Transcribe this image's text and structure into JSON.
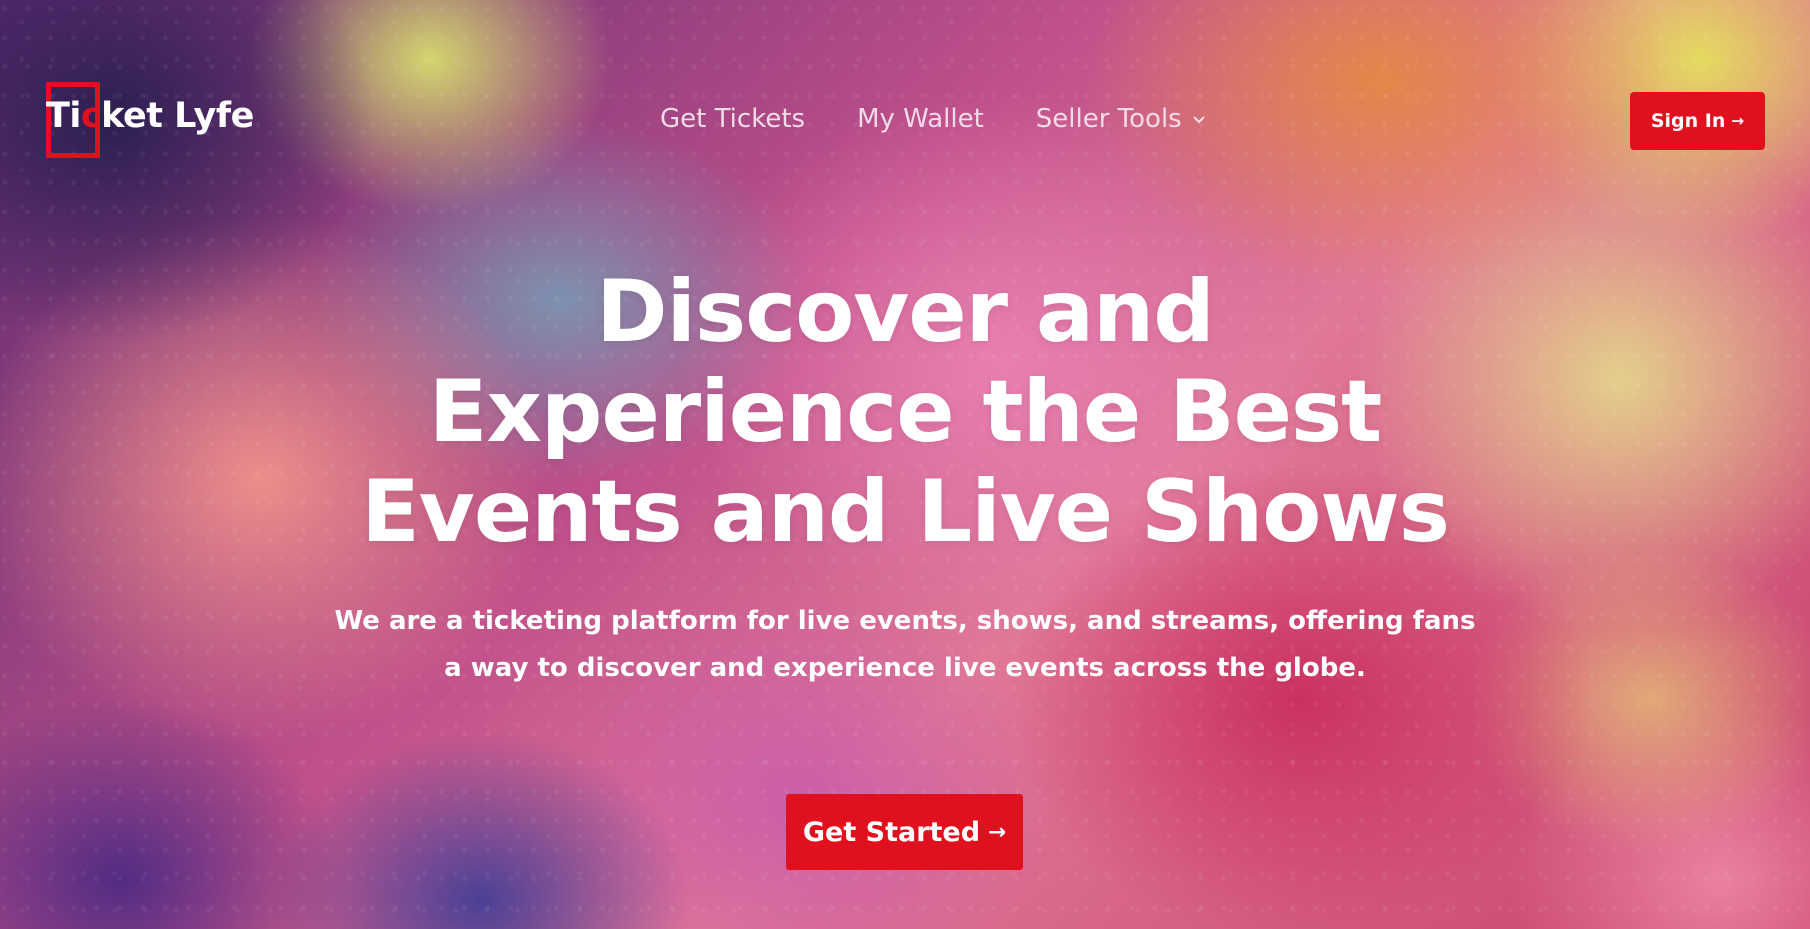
{
  "brand": {
    "name_prefix": "Ti",
    "name_accent": "c",
    "name_suffix": "ket Lyfe",
    "accent_color": "#e0101e"
  },
  "nav": {
    "items": [
      {
        "label": "Get Tickets"
      },
      {
        "label": "My Wallet"
      },
      {
        "label": "Seller Tools",
        "icon": "chevron-down-icon"
      }
    ]
  },
  "header": {
    "signin_label": "Sign In",
    "signin_icon": "arrow-right-icon"
  },
  "hero": {
    "title_line1": "Discover and",
    "title_line2": "Experience the Best",
    "title_line3": "Events and Live Shows",
    "subtitle": "We are a ticketing platform for live events, shows, and streams, offering fans a way to discover and experience live events across the globe.",
    "cta_label": "Get Started",
    "cta_icon": "arrow-right-icon"
  }
}
